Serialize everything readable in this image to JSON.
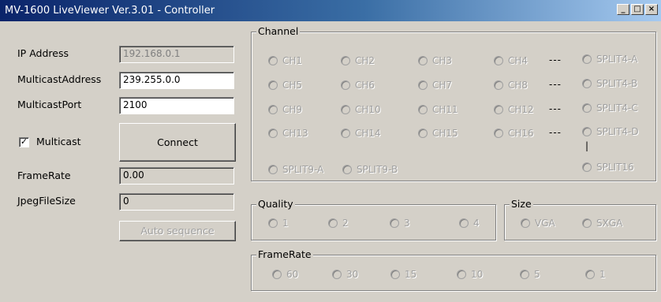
{
  "window": {
    "title": "MV-1600 LiveViewer Ver.3.01 - Controller"
  },
  "left": {
    "ip_label": "IP Address",
    "ip_value": "192.168.0.1",
    "mcaddr_label": "MulticastAddress",
    "mcaddr_value": "239.255.0.0",
    "mcport_label": "MulticastPort",
    "mcport_value": "2100",
    "multicast_label": "Multicast",
    "multicast_checked": "✓",
    "connect_label": "Connect",
    "framerate_label": "FrameRate",
    "framerate_value": "0.00",
    "jpeg_label": "JpegFileSize",
    "jpeg_value": "0",
    "auto_label": "Auto sequence"
  },
  "channel": {
    "title": "Channel",
    "rows": [
      [
        "CH1",
        "CH2",
        "CH3",
        "CH4"
      ],
      [
        "CH5",
        "CH6",
        "CH7",
        "CH8"
      ],
      [
        "CH9",
        "CH10",
        "CH11",
        "CH12"
      ],
      [
        "CH13",
        "CH14",
        "CH15",
        "CH16"
      ]
    ],
    "split4": [
      "SPLIT4-A",
      "SPLIT4-B",
      "SPLIT4-C",
      "SPLIT4-D"
    ],
    "dash": "---",
    "bar": "|",
    "split9a": "SPLIT9-A",
    "split9b": "SPLIT9-B",
    "split16": "SPLIT16"
  },
  "quality": {
    "title": "Quality",
    "options": [
      "1",
      "2",
      "3",
      "4"
    ]
  },
  "size": {
    "title": "Size",
    "options": [
      "VGA",
      "SXGA"
    ]
  },
  "framerate_group": {
    "title": "FrameRate",
    "options": [
      "60",
      "30",
      "15",
      "10",
      "5",
      "1"
    ]
  }
}
